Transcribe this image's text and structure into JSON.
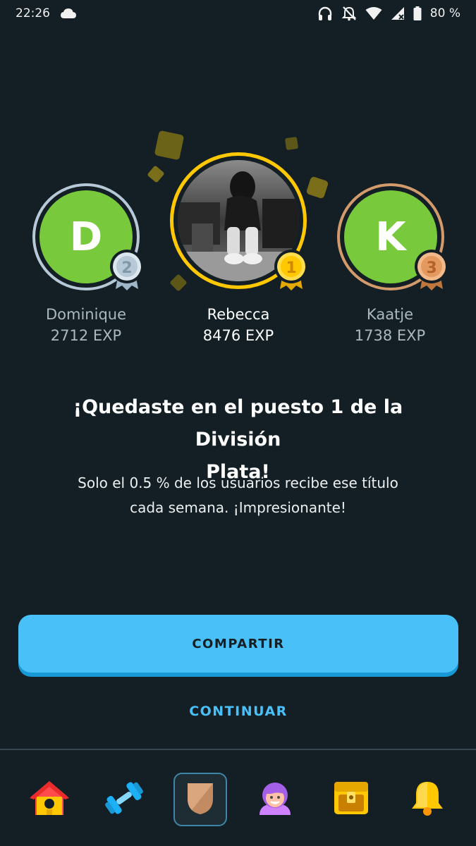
{
  "status_bar": {
    "time": "22:26",
    "battery": "80 %",
    "icons": [
      "cloud-icon",
      "headphones-icon",
      "notifications-off-icon",
      "wifi-icon",
      "signal-icon",
      "battery-icon"
    ]
  },
  "podium": {
    "players": [
      {
        "rank": "2",
        "initial": "D",
        "name": "Dominique",
        "exp": "2712 EXP",
        "ring_color": "#b7c9d6",
        "medal": "silver-medal-icon"
      },
      {
        "rank": "1",
        "initial": "",
        "name": "Rebecca",
        "exp": "8476 EXP",
        "ring_color": "#ffc800",
        "medal": "gold-medal-icon",
        "avatar": "photo"
      },
      {
        "rank": "3",
        "initial": "K",
        "name": "Kaatje",
        "exp": "1738 EXP",
        "ring_color": "#d39b6c",
        "medal": "bronze-medal-icon"
      }
    ]
  },
  "result": {
    "headline_line1": "¡Quedaste en el puesto 1 de la División",
    "headline_line2": "Plata!",
    "subline_line1": "Solo el 0.5 % de los usuarios recibe ese título",
    "subline_line2": "cada semana. ¡Impresionante!"
  },
  "actions": {
    "share_label": "COMPARTIR",
    "continue_label": "CONTINUAR"
  },
  "bottom_nav": {
    "items": [
      {
        "name": "home-icon",
        "active": false
      },
      {
        "name": "dumbbell-icon",
        "active": false
      },
      {
        "name": "league-shield-icon",
        "active": true
      },
      {
        "name": "profile-avatar-icon",
        "active": false
      },
      {
        "name": "treasure-chest-icon",
        "active": false
      },
      {
        "name": "bell-icon",
        "active": false
      }
    ]
  },
  "colors": {
    "background": "#131f24",
    "accent_blue": "#49c0f8",
    "green": "#78c93c",
    "gold": "#ffc800"
  }
}
